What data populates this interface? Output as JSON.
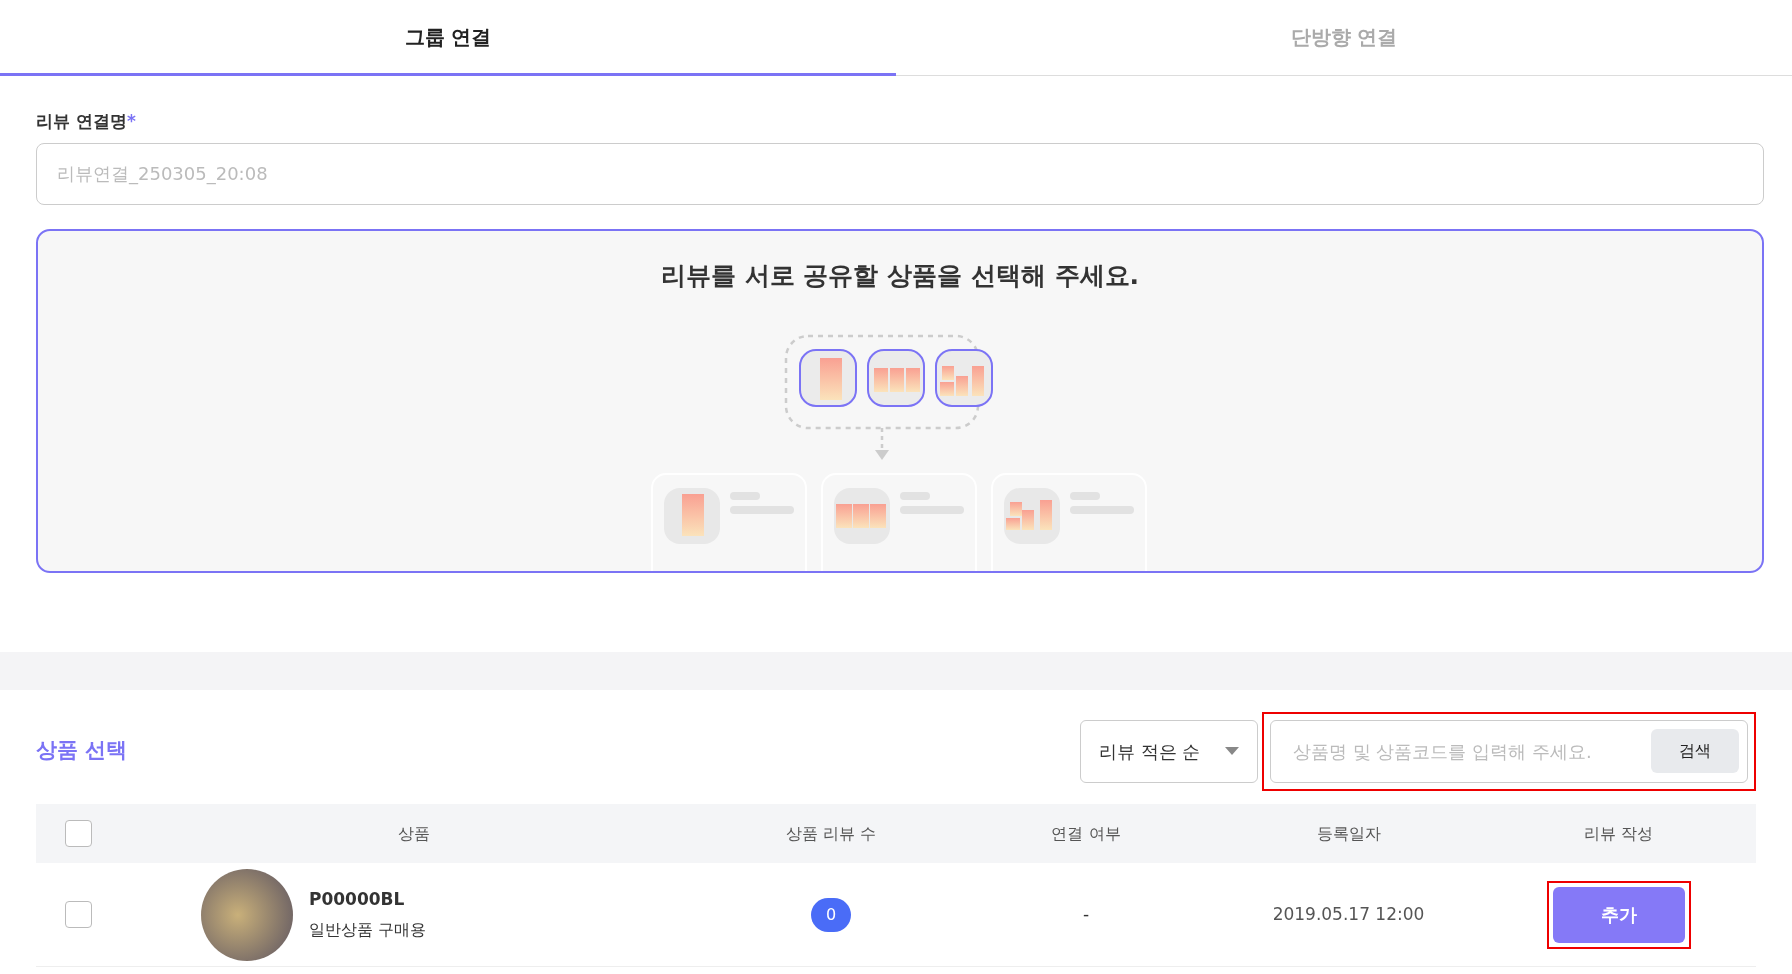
{
  "tabs": [
    {
      "label": "그룹 연결",
      "selected": true
    },
    {
      "label": "단방향 연결",
      "selected": false
    }
  ],
  "name_field": {
    "label": "리뷰 연결명",
    "required_mark": "*",
    "placeholder": "리뷰연결_250305_20:08"
  },
  "guide": {
    "title": "리뷰를 서로 공유할 상품을 선택해 주세요."
  },
  "product_select": {
    "title": "상품 선택",
    "sort": "리뷰 적은 순",
    "search_placeholder": "상품명 및 상품코드를 입력해 주세요.",
    "search_button": "검색"
  },
  "table": {
    "select_all_checked": false,
    "columns": [
      "상품",
      "상품 리뷰 수",
      "연결 여부",
      "등록일자",
      "리뷰 작성"
    ],
    "rows": [
      {
        "checked": false,
        "code": "P00000BL",
        "type": "일반상품 구매용",
        "review_count": "0",
        "linked": "-",
        "date": "2019.05.17 12:00",
        "action": "추가"
      }
    ]
  }
}
